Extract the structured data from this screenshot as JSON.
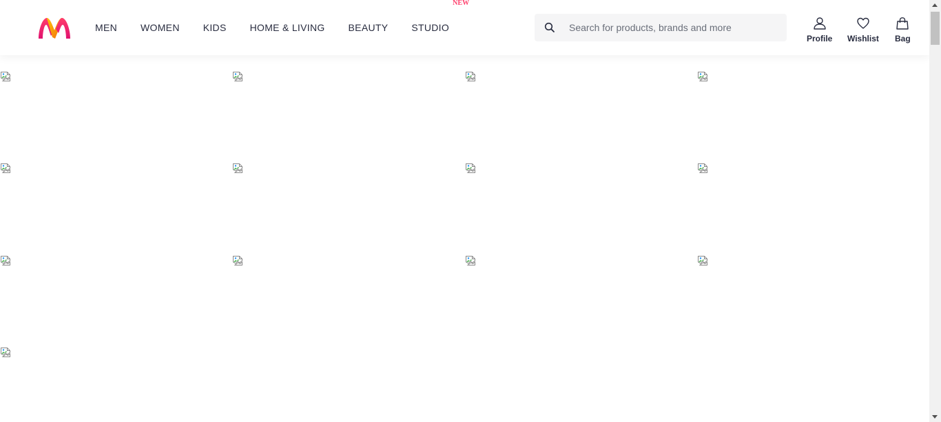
{
  "header": {
    "logo_icon": "myntra-logo-icon",
    "brand_colors": {
      "pink": "#ff3f6c",
      "magenta": "#e0116f",
      "orange": "#f26a10",
      "yellow": "#ffc700"
    },
    "nav": [
      {
        "label": "MEN"
      },
      {
        "label": "WOMEN"
      },
      {
        "label": "KIDS"
      },
      {
        "label": "HOME & LIVING"
      },
      {
        "label": "BEAUTY"
      },
      {
        "label": "STUDIO",
        "badge": "NEW"
      }
    ],
    "search": {
      "icon": "search-icon",
      "placeholder": "Search for products, brands and more"
    },
    "actions": [
      {
        "label": "Profile",
        "icon": "profile-icon"
      },
      {
        "label": "Wishlist",
        "icon": "heart-icon"
      },
      {
        "label": "Bag",
        "icon": "bag-icon"
      }
    ]
  },
  "content": {
    "broken_image_icon": "broken-image-icon",
    "image_count": 13
  }
}
